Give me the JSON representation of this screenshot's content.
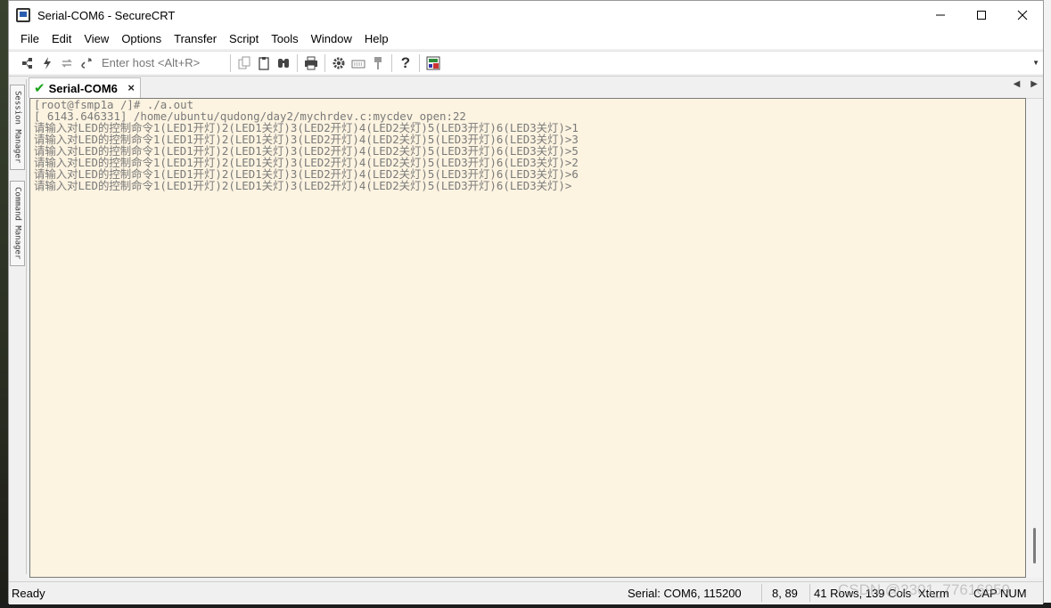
{
  "window": {
    "title": "Serial-COM6 - SecureCRT",
    "minimize_label": "—",
    "maximize_label": "☐",
    "close_label": "✕"
  },
  "menu": [
    "File",
    "Edit",
    "View",
    "Options",
    "Transfer",
    "Script",
    "Tools",
    "Window",
    "Help"
  ],
  "toolbar": {
    "host_placeholder": "Enter host <Alt+R>",
    "icons": [
      "connect-icon",
      "quick-connect-icon",
      "reconnect-icon",
      "disconnect-icon",
      "copy-icon",
      "paste-icon",
      "find-icon",
      "print-icon",
      "settings-icon",
      "keymap-icon",
      "tools-icon",
      "help-icon",
      "session-icon"
    ]
  },
  "tab": {
    "label": "Serial-COM6",
    "close": "×"
  },
  "side_panel": {
    "session_manager": "Session Manager",
    "command_manager": "Command Manager"
  },
  "terminal": {
    "lines": [
      "[root@fsmp1a /]# ./a.out",
      "[ 6143.646331] /home/ubuntu/qudong/day2/mychrdev.c:mycdev_open:22",
      "请输入对LED的控制命令1(LED1开灯)2(LED1关灯)3(LED2开灯)4(LED2关灯)5(LED3开灯)6(LED3关灯)>1",
      "请输入对LED的控制命令1(LED1开灯)2(LED1关灯)3(LED2开灯)4(LED2关灯)5(LED3开灯)6(LED3关灯)>3",
      "请输入对LED的控制命令1(LED1开灯)2(LED1关灯)3(LED2开灯)4(LED2关灯)5(LED3开灯)6(LED3关灯)>5",
      "请输入对LED的控制命令1(LED1开灯)2(LED1关灯)3(LED2开灯)4(LED2关灯)5(LED3开灯)6(LED3关灯)>2",
      "请输入对LED的控制命令1(LED1开灯)2(LED1关灯)3(LED2开灯)4(LED2关灯)5(LED3开灯)6(LED3关灯)>6",
      "请输入对LED的控制命令1(LED1开灯)2(LED1关灯)3(LED2开灯)4(LED2关灯)5(LED3开灯)6(LED3关灯)>"
    ],
    "background": "#fcf3e0",
    "text_color": "#7a7a7a"
  },
  "status": {
    "ready": "Ready",
    "connection": "Serial: COM6, 115200",
    "cursor": "8,  89",
    "size": "41 Rows, 139 Cols",
    "terminal_type": "Xterm",
    "caps": "CAP",
    "num": "NUM"
  },
  "watermark": "CSDN @2301_77616959"
}
